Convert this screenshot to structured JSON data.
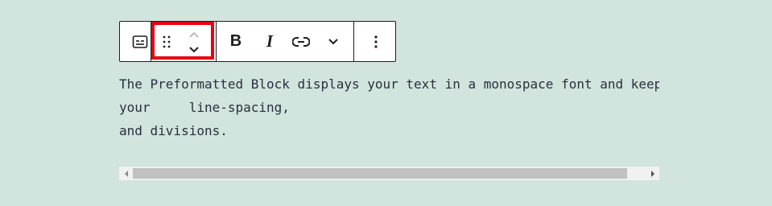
{
  "toolbar": {
    "buttons": [
      {
        "name": "block-type",
        "icon": "preformatted-icon",
        "tooltip": ""
      },
      {
        "name": "drag-handle",
        "icon": "drag-dots-icon"
      },
      {
        "name": "move-up",
        "icon": "chevron-up-icon"
      },
      {
        "name": "move-down",
        "icon": "chevron-down-icon"
      },
      {
        "name": "bold",
        "icon": "bold-icon",
        "label": "B"
      },
      {
        "name": "italic",
        "icon": "italic-icon",
        "label": "I"
      },
      {
        "name": "link",
        "icon": "link-icon"
      },
      {
        "name": "more-rich-text",
        "icon": "chevron-down-icon"
      },
      {
        "name": "options",
        "icon": "vertical-ellipsis-icon"
      }
    ],
    "highlight_color": "#e8000f"
  },
  "preformatted": {
    "line1": "The Preformatted Block displays your text in a monospace font and keeps",
    "line2": "your     line-spacing,",
    "line3": "and divisions."
  },
  "colors": {
    "background": "#d1e4dd",
    "text": "#28303d",
    "toolbar_border": "#1e1e1e",
    "scroll_thumb": "#c1c1c1",
    "scroll_track": "#f1f1f1"
  }
}
